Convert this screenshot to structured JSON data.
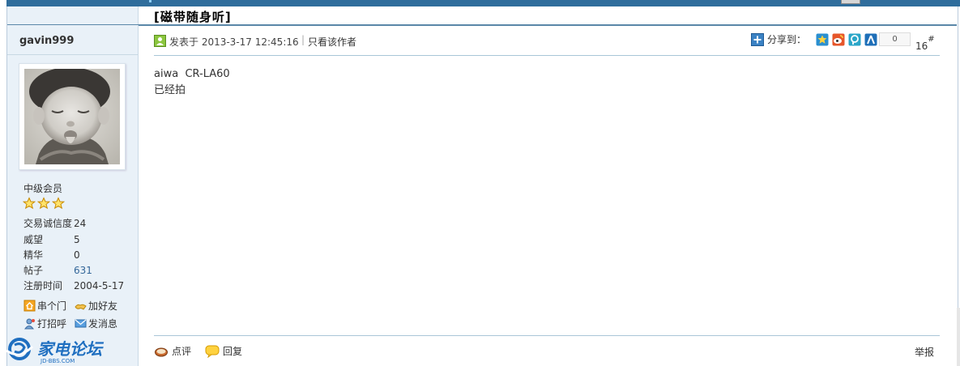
{
  "thread": {
    "title": "[磁带随身听]"
  },
  "author": {
    "username": "gavin999",
    "group": "中级会员",
    "stars": 3,
    "stats": [
      {
        "label": "交易诚信度",
        "value": "24"
      },
      {
        "label": "威望",
        "value": "5"
      },
      {
        "label": "精华",
        "value": "0"
      },
      {
        "label": "帖子",
        "value": "631"
      },
      {
        "label": "注册时间",
        "value": "2004-5-17"
      }
    ],
    "actions": {
      "visit": "串个门",
      "add_friend": "加好友",
      "greet": "打招呼",
      "message": "发消息"
    }
  },
  "post": {
    "meta": "发表于 2013-3-17 12:45:16",
    "only_author": "只看该作者",
    "share_label": "分享到：",
    "share_count": "0",
    "floor": "16",
    "floor_suffix": "#",
    "content": [
      "aiwa  CR-LA60",
      "已经拍"
    ]
  },
  "footer": {
    "comment": "点评",
    "reply": "回复",
    "report": "举报"
  },
  "logo": {
    "name": "家电论坛",
    "domain": "JD-BBS.COM"
  },
  "colors": {
    "accent": "#2f6d9c",
    "sidebar_bg": "#e9f1f8",
    "link": "#336699",
    "line": "#a9c6d8"
  }
}
